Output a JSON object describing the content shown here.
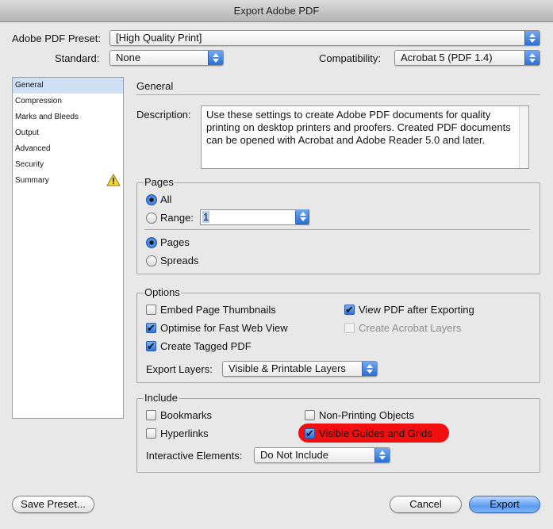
{
  "window": {
    "title": "Export Adobe PDF"
  },
  "preset": {
    "label": "Adobe PDF Preset:",
    "value": "[High Quality Print]"
  },
  "standard": {
    "label": "Standard:",
    "value": "None"
  },
  "compatibility": {
    "label": "Compatibility:",
    "value": "Acrobat 5 (PDF 1.4)"
  },
  "sidebar": {
    "items": [
      {
        "label": "General",
        "selected": true
      },
      {
        "label": "Compression"
      },
      {
        "label": "Marks and Bleeds"
      },
      {
        "label": "Output"
      },
      {
        "label": "Advanced"
      },
      {
        "label": "Security"
      },
      {
        "label": "Summary",
        "icon": "warning-icon"
      }
    ]
  },
  "panel": {
    "title": "General",
    "description_label": "Description:",
    "description_text": "Use these settings to create Adobe PDF documents for quality printing on desktop printers and proofers.  Created PDF documents can be opened with Acrobat and Adobe Reader 5.0 and later."
  },
  "pages": {
    "title": "Pages",
    "all_label": "All",
    "range_label": "Range:",
    "range_value": "1",
    "pages_label": "Pages",
    "spreads_label": "Spreads",
    "selected_scope": "All",
    "selected_layout": "Pages"
  },
  "options": {
    "title": "Options",
    "embed_thumbnails": {
      "label": "Embed Page Thumbnails",
      "checked": false
    },
    "optimise_web": {
      "label": "Optimise for Fast Web View",
      "checked": true
    },
    "tagged_pdf": {
      "label": "Create Tagged PDF",
      "checked": true
    },
    "view_after": {
      "label": "View PDF after Exporting",
      "checked": true
    },
    "acrobat_layers": {
      "label": "Create Acrobat Layers",
      "checked": false,
      "disabled": true
    },
    "export_layers_label": "Export Layers:",
    "export_layers_value": "Visible & Printable Layers"
  },
  "include": {
    "title": "Include",
    "bookmarks": {
      "label": "Bookmarks",
      "checked": false
    },
    "hyperlinks": {
      "label": "Hyperlinks",
      "checked": false
    },
    "non_printing": {
      "label": "Non-Printing Objects",
      "checked": false
    },
    "guides_grids": {
      "label": "Visible Guides and Grids",
      "checked": true,
      "highlight_color": "#f20f0f"
    },
    "interactive_label": "Interactive Elements:",
    "interactive_value": "Do Not Include"
  },
  "buttons": {
    "save_preset": "Save Preset...",
    "cancel": "Cancel",
    "export": "Export"
  },
  "colors": {
    "accent": "#2a6fd6",
    "selection": "#cfdff4",
    "highlight": "#f20f0f"
  }
}
